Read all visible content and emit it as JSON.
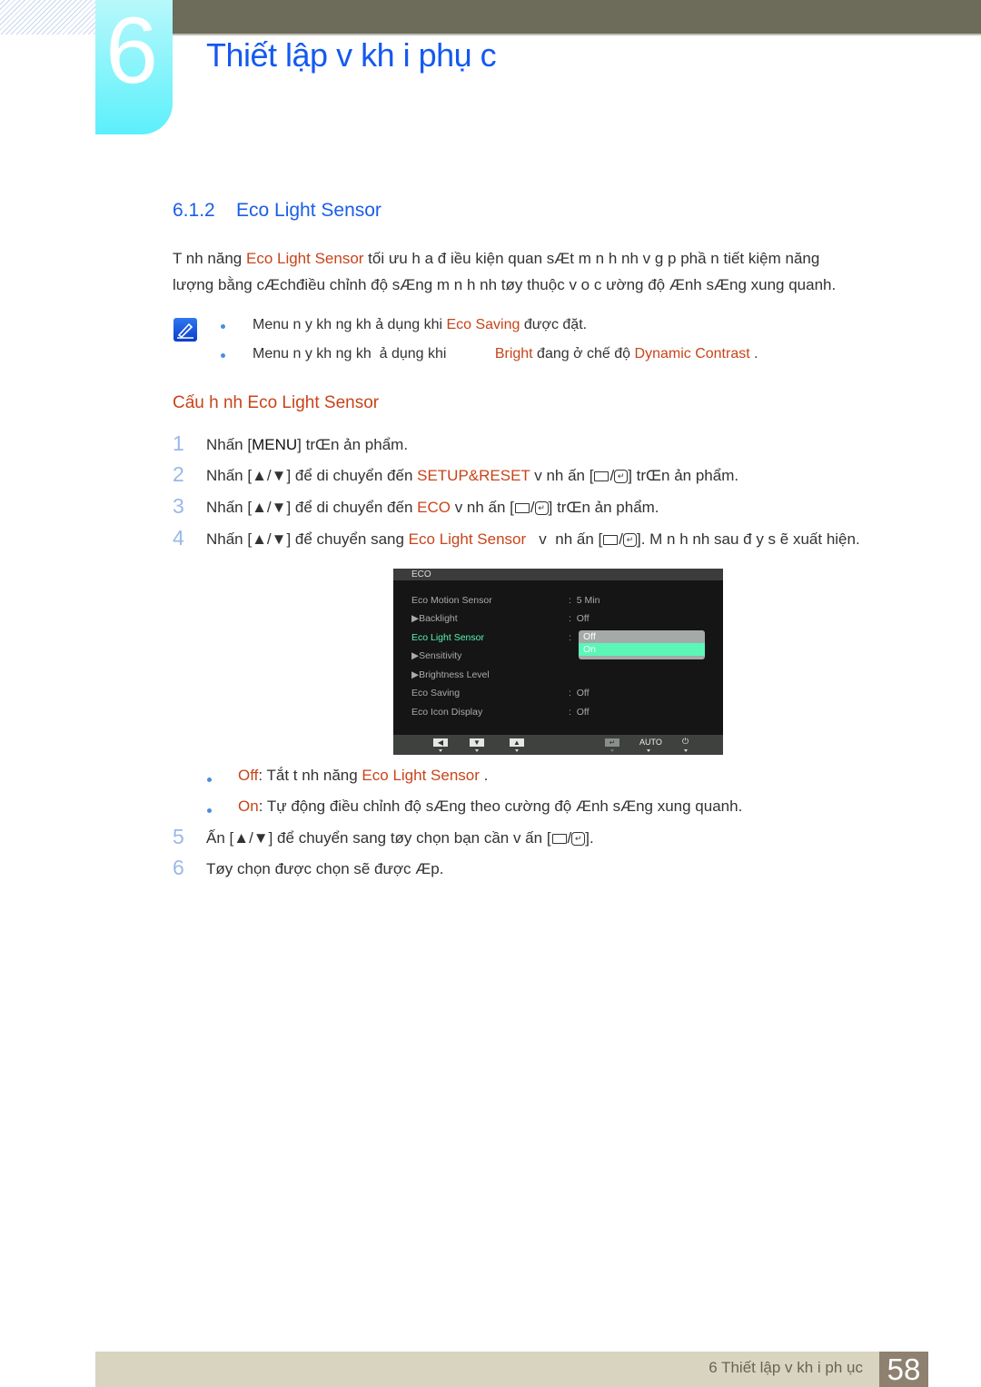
{
  "chapter": {
    "number": "6",
    "title": "Thiết lập v  kh i phụ    c"
  },
  "section": {
    "number": "6.1.2",
    "title": "Eco Light Sensor"
  },
  "intro": {
    "line1_pre": "T nh năng ",
    "line1_hl": "Eco Light Sensor",
    "line1_post": "   tối ưu h a đ iều kiện quan sÆt m n h nh v  g p phầ n tiết kiệm năng",
    "line2": "lượng bằng cÆchđiều chỉnh độ sÆng m n h nh tøy thuộc v o c ường độ Ænh sÆng xung quanh."
  },
  "notes": [
    {
      "pre": "Menu n y kh ng kh  ả dụng khi ",
      "hl": "Eco Saving",
      "post": "  được đặt."
    },
    {
      "pre": "Menu n y kh ng kh  ả dụng khi            ",
      "hl": "Bright",
      "mid": "  đang ở chế độ ",
      "hl2": "Dynamic Contrast",
      "post": "  ."
    }
  ],
  "subheading": "Cấu h nh Eco Light Sensor",
  "steps": [
    {
      "num": "1",
      "pre": "Nhấn [",
      "key": "MENU",
      "post": "] trŒn ản phẩm."
    },
    {
      "num": "2",
      "pre": "Nhấn [▲/▼] để di chuyển đến ",
      "hl": "SETUP&RESET",
      "mid": " v  nh ấn [",
      "post": "] trŒn ản phẩm."
    },
    {
      "num": "3",
      "pre": "Nhấn [▲/▼] để di chuyển đến ",
      "hl": "ECO",
      "mid": " v  nh ấn [",
      "post": "] trŒn ản phẩm."
    },
    {
      "num": "4",
      "pre": "Nhấn [▲/▼] để chuyển sang ",
      "hl": "Eco Light Sensor",
      "mid": "   v  nh ấn [",
      "post": "]. M n h nh sau đ  y s ẽ xuất hiện."
    },
    {
      "num": "5",
      "pre": "Ấn [▲/▼] để chuyển sang tøy chọn bạn cần v   ấn [",
      "post": "]."
    },
    {
      "num": "6",
      "pre": "Tøy chọn được chọn sẽ được Æp."
    }
  ],
  "options": [
    {
      "hl": "Off",
      "pre": ": Tắt t nh năng ",
      "hl2": "Eco Light Sensor",
      "post": "  ."
    },
    {
      "hl": "On",
      "pre": ": Tự động điều chỉnh độ sÆng theo cường độ Ænh sÆng xung quanh."
    }
  ],
  "osd": {
    "title": "ECO",
    "rows": [
      {
        "label": "Eco Motion Sensor",
        "value": "5 Min",
        "selected": false,
        "sub": false
      },
      {
        "label": "▶Backlight",
        "value": "Off",
        "selected": false,
        "sub": true
      },
      {
        "label": "Eco Light Sensor",
        "value": "",
        "selected": true,
        "sub": false
      },
      {
        "label": "▶Sensitivity",
        "value": "",
        "selected": false,
        "sub": true
      },
      {
        "label": "▶Brightness Level",
        "value": "",
        "selected": false,
        "sub": true
      },
      {
        "label": "Eco Saving",
        "value": "Off",
        "selected": false,
        "sub": false
      },
      {
        "label": "Eco Icon Display",
        "value": "Off",
        "selected": false,
        "sub": false
      }
    ],
    "dropdown": [
      "Off",
      "On"
    ],
    "dropdown_selected": "On",
    "buttons": {
      "left": "◀",
      "down": "▼",
      "up": "▲",
      "enter": "↵",
      "auto": "AUTO",
      "power": "⏻"
    }
  },
  "footer": {
    "text": "6 Thiết lập v  kh i ph    ục",
    "page": "58"
  },
  "colors": {
    "accent_blue": "#1459f0",
    "highlight": "#c8441a",
    "osd_selected": "#59f0b5"
  }
}
